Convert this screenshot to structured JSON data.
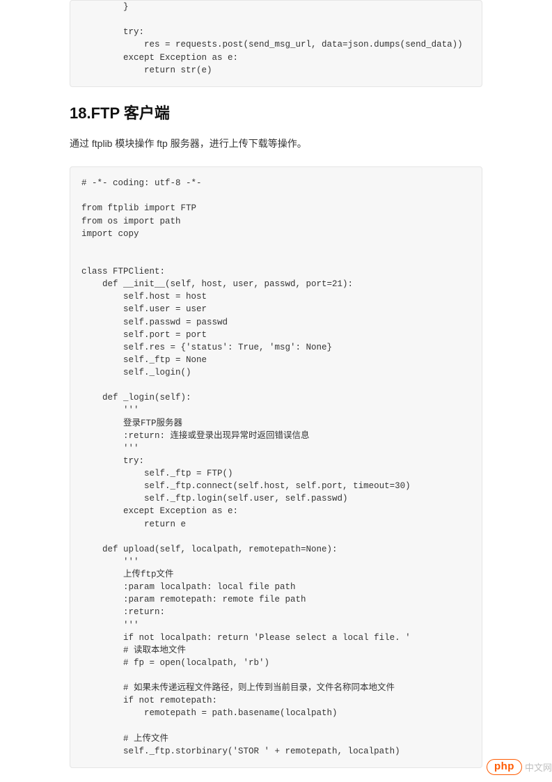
{
  "code_block_1": "        }\n\n        try:\n            res = requests.post(send_msg_url, data=json.dumps(send_data))\n        except Exception as e:\n            return str(e)",
  "section_heading": "18.FTP 客户端",
  "description": "通过 ftplib 模块操作 ftp 服务器，进行上传下载等操作。",
  "code_block_2": "# -*- coding: utf-8 -*-\n\nfrom ftplib import FTP\nfrom os import path\nimport copy\n\n\nclass FTPClient:\n    def __init__(self, host, user, passwd, port=21):\n        self.host = host\n        self.user = user\n        self.passwd = passwd\n        self.port = port\n        self.res = {'status': True, 'msg': None}\n        self._ftp = None\n        self._login()\n\n    def _login(self):\n        '''\n        登录FTP服务器\n        :return: 连接或登录出现异常时返回错误信息\n        '''\n        try:\n            self._ftp = FTP()\n            self._ftp.connect(self.host, self.port, timeout=30)\n            self._ftp.login(self.user, self.passwd)\n        except Exception as e:\n            return e\n\n    def upload(self, localpath, remotepath=None):\n        '''\n        上传ftp文件\n        :param localpath: local file path\n        :param remotepath: remote file path\n        :return:\n        '''\n        if not localpath: return 'Please select a local file. '\n        # 读取本地文件\n        # fp = open(localpath, 'rb')\n\n        # 如果未传递远程文件路径，则上传到当前目录，文件名称同本地文件\n        if not remotepath:\n            remotepath = path.basename(localpath)\n\n        # 上传文件\n        self._ftp.storbinary('STOR ' + remotepath, localpath)",
  "footer": {
    "badge_text": "php",
    "site_text": "中文网"
  }
}
